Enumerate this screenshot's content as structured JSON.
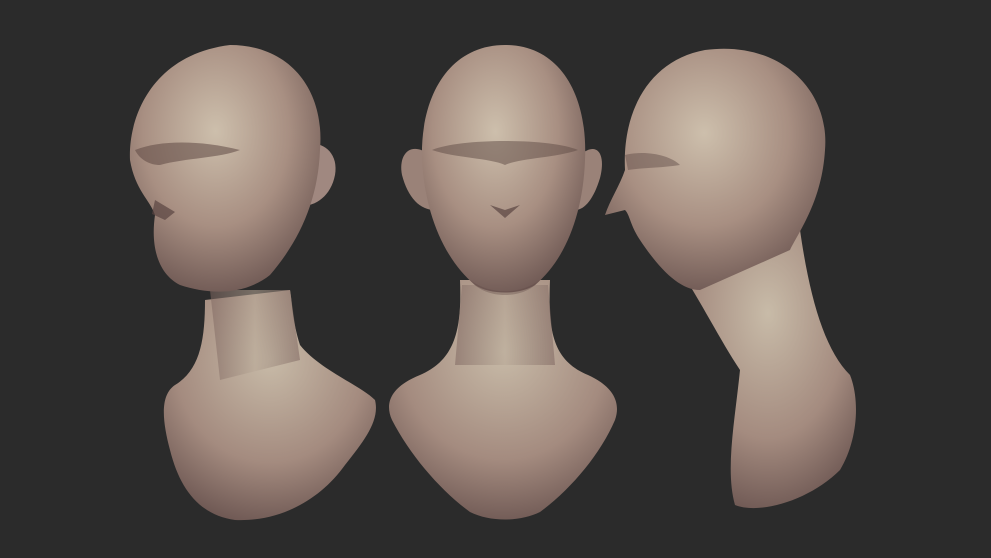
{
  "scene": {
    "background_color": "#2b2b2b",
    "skin_light": "#c9b9a6",
    "skin_mid": "#9e8578",
    "skin_dark": "#5e4944",
    "views": [
      "three-quarter",
      "front",
      "side"
    ]
  }
}
